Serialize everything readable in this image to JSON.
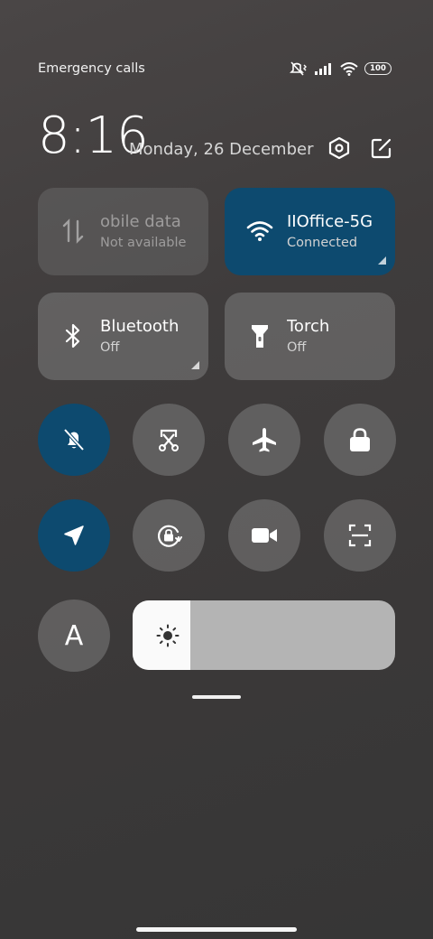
{
  "status_bar": {
    "carrier_text": "Emergency calls o",
    "battery_level": "100",
    "icons": [
      "silent-vibrate-icon",
      "signal-icon",
      "wifi-icon",
      "battery-icon"
    ]
  },
  "header": {
    "time": "8:16",
    "date": "Monday, 26 December",
    "settings_icon": "settings-hex-icon",
    "edit_icon": "edit-icon"
  },
  "tiles": [
    {
      "title": "obile data",
      "subtitle": "Not available",
      "state": "disabled",
      "icon": "mobile-data-icon"
    },
    {
      "title": "IIOffice-5G",
      "subtitle": "Connected",
      "state": "active",
      "icon": "wifi-icon"
    },
    {
      "title": "Bluetooth",
      "subtitle": "Off",
      "state": "off",
      "icon": "bluetooth-icon"
    },
    {
      "title": "Torch",
      "subtitle": "Off",
      "state": "off",
      "icon": "torch-icon"
    }
  ],
  "toggles": [
    {
      "name": "mute",
      "icon": "bell-off-icon",
      "active": true
    },
    {
      "name": "screenshot",
      "icon": "screenshot-icon",
      "active": false
    },
    {
      "name": "airplane",
      "icon": "airplane-icon",
      "active": false
    },
    {
      "name": "lock",
      "icon": "lock-icon",
      "active": false
    },
    {
      "name": "location",
      "icon": "location-arrow-icon",
      "active": true
    },
    {
      "name": "rotation-lock",
      "icon": "rotation-lock-icon",
      "active": false
    },
    {
      "name": "screen-record",
      "icon": "video-camera-icon",
      "active": false
    },
    {
      "name": "scanner",
      "icon": "scan-icon",
      "active": false
    }
  ],
  "auto_brightness_label": "A",
  "brightness": {
    "level": 0.22,
    "icon": "sun-icon"
  },
  "colors": {
    "accent": "#0d4a6f",
    "tile": "#6f6f6f",
    "slider_track": "#b4b4b4",
    "slider_fill": "#fafafa"
  }
}
